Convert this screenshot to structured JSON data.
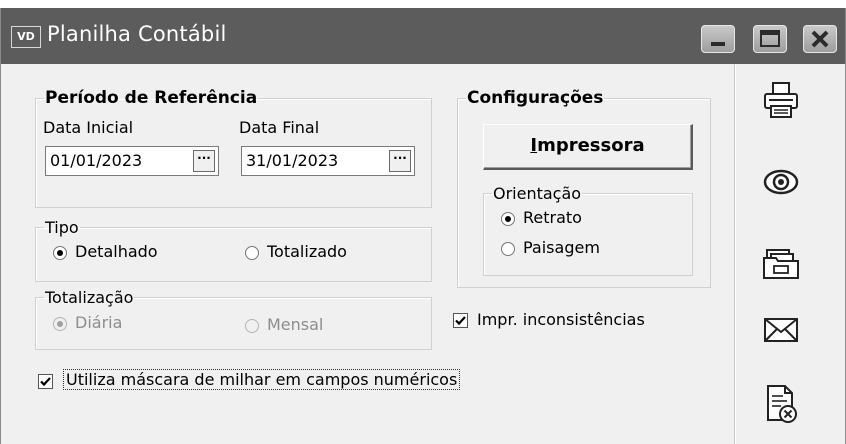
{
  "window": {
    "app_badge": "VD",
    "title": "Planilha Contábil",
    "controls": [
      "minimize-icon",
      "maximize-icon",
      "close-icon"
    ]
  },
  "periodo": {
    "legend": "Período de Referência",
    "data_inicial_label": "Data Inicial",
    "data_inicial_value": "01/01/2023",
    "data_final_label": "Data Final",
    "data_final_value": "31/01/2023",
    "picker_label": "···"
  },
  "tipo": {
    "legend": "Tipo",
    "options": [
      {
        "label": "Detalhado",
        "selected": true
      },
      {
        "label": "Totalizado",
        "selected": false
      }
    ]
  },
  "totalizacao": {
    "legend": "Totalização",
    "enabled": false,
    "options": [
      {
        "label": "Diária",
        "selected": true
      },
      {
        "label": "Mensal",
        "selected": false
      }
    ]
  },
  "configuracoes": {
    "legend": "Configurações",
    "impressora_first": "I",
    "impressora_rest": "mpressora",
    "orientacao": {
      "legend": "Orientação",
      "options": [
        {
          "label": "Retrato",
          "selected": true
        },
        {
          "label": "Paisagem",
          "selected": false
        }
      ]
    }
  },
  "checkboxes": {
    "inconsistencias": {
      "label": "Impr. inconsistências",
      "checked": true
    },
    "mascara": {
      "label": "Utiliza máscara de milhar em campos numéricos",
      "checked": true
    }
  },
  "sidebar": {
    "icons": [
      "printer-icon",
      "eye-icon",
      "folder-icon",
      "envelope-icon",
      "cancel-document-icon"
    ]
  },
  "colors": {
    "titlebar": "#5c5c5c",
    "window_bg": "#f0f0f0"
  }
}
